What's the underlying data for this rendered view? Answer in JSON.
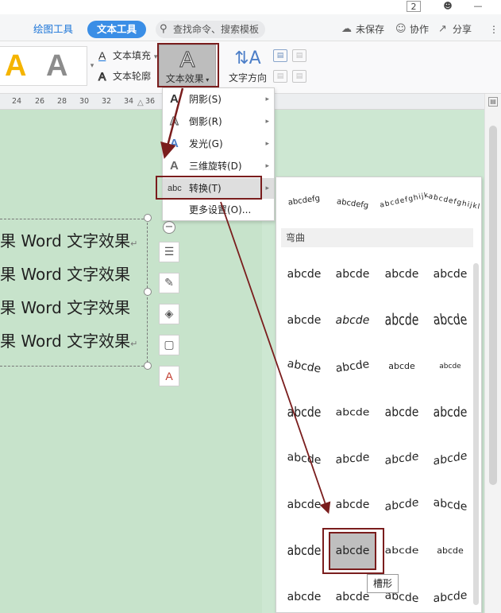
{
  "title_strip": {
    "badge": "2",
    "min_glyph": "—"
  },
  "tabs": {
    "drawing_tools": "绘图工具",
    "text_tools": "文本工具"
  },
  "search": {
    "label": "查找命令、搜索模板"
  },
  "top_actions": {
    "unsaved": "未保存",
    "collab": "协作",
    "share": "分享"
  },
  "ribbon": {
    "text_fill": "文本填充",
    "text_outline": "文本轮廓",
    "text_effect": "文本效果",
    "text_direction": "文字方向"
  },
  "ruler": {
    "ticks": [
      "24",
      "26",
      "28",
      "30",
      "32",
      "34",
      "36"
    ]
  },
  "document": {
    "lines": [
      "果 Word 文字效果",
      "果 Word 文字效果",
      "果 Word 文字效果",
      "果 Word 文字效果"
    ]
  },
  "menu": {
    "items": [
      {
        "icon": "A",
        "label": "阴影(S)"
      },
      {
        "icon": "A",
        "label": "倒影(R)"
      },
      {
        "icon": "A",
        "label": "发光(G)"
      },
      {
        "icon": "A",
        "label": "三维旋转(D)"
      },
      {
        "icon": "abc",
        "label": "转换(T)"
      },
      {
        "label": "更多设置(O)..."
      }
    ]
  },
  "gallery": {
    "arc_row": [
      "abcdefg",
      "abcdefg",
      "abcdefghijk",
      "abcdefghijkl"
    ],
    "section_label": "弯曲",
    "cells": [
      [
        "abcde",
        "abcde",
        "abcde",
        "abcde"
      ],
      [
        "abcde",
        "abcde",
        "abcde",
        "abcde"
      ],
      [
        "abcde",
        "abcde",
        "abcde",
        "abcde"
      ],
      [
        "abcde",
        "abcde",
        "abcde",
        "abcde"
      ],
      [
        "abcde",
        "abcde",
        "abcde",
        "abcde"
      ],
      [
        "abcde",
        "abcde",
        "abcde",
        "abcde"
      ],
      [
        "abcde",
        "abcde",
        "abcde",
        "abcde"
      ],
      [
        "abcde",
        "abcde",
        "abcde",
        "abcde"
      ]
    ],
    "tooltip": "槽形"
  },
  "colors": {
    "accent": "#3a8ee6",
    "highlight": "#7a1d1d",
    "page": "#c7e3cb"
  }
}
